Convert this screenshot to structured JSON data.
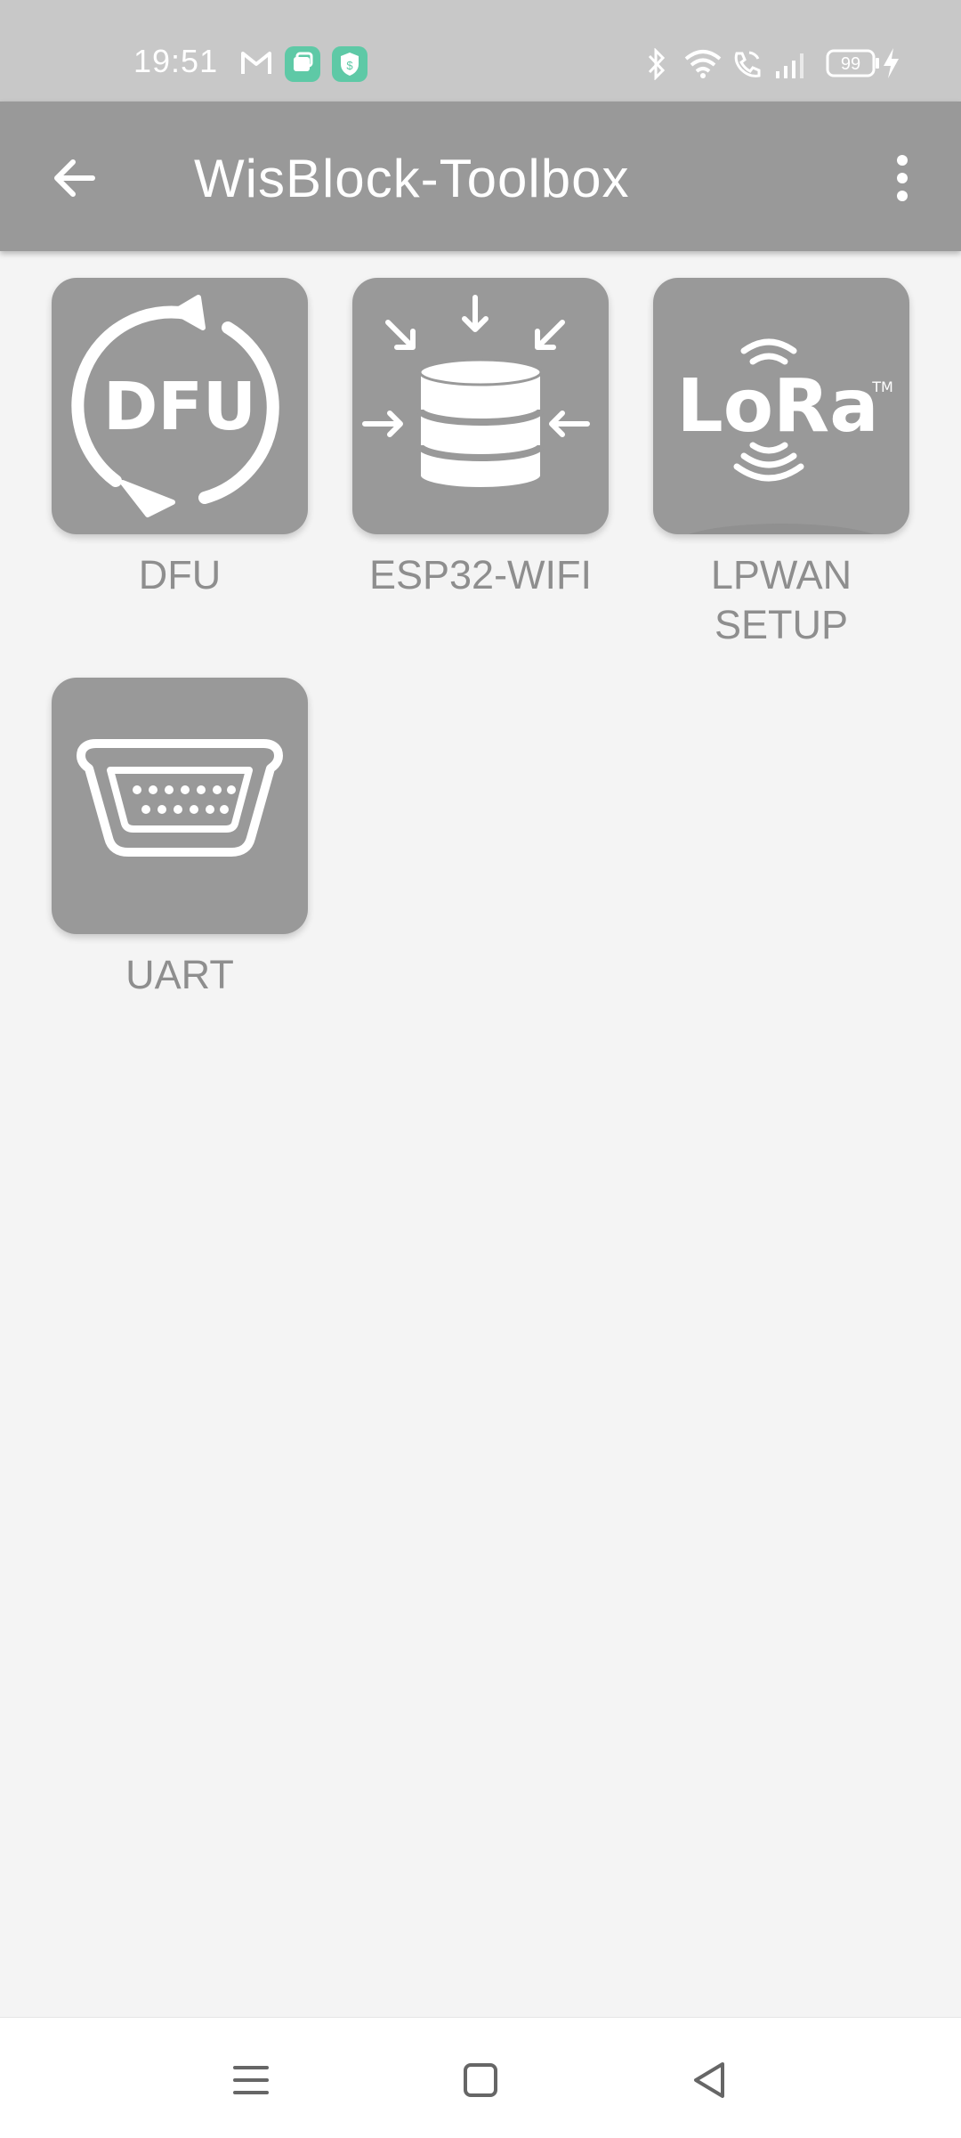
{
  "status_bar": {
    "time": "19:51",
    "battery": "99",
    "left_icons": [
      "gmail-icon",
      "notification-app-icon",
      "security-app-icon"
    ],
    "right_icons": [
      "bluetooth-icon",
      "wifi-icon",
      "wifi-calling-icon",
      "signal-icon",
      "battery-icon",
      "charging-icon"
    ]
  },
  "app_bar": {
    "title": "WisBlock-Toolbox",
    "back_icon": "arrow-back-icon",
    "menu_icon": "more-vert-icon"
  },
  "tiles": [
    {
      "label": "DFU",
      "icon": "dfu-icon",
      "icon_text": "DFU"
    },
    {
      "label": "ESP32-WIFI",
      "icon": "database-icon"
    },
    {
      "label": "LPWAN\nSETUP",
      "icon": "lora-icon",
      "icon_text": "LoRa",
      "icon_tm": "TM"
    },
    {
      "label": "UART",
      "icon": "serial-port-icon"
    }
  ],
  "nav_bar": {
    "buttons": [
      "menu-icon",
      "home-icon",
      "back-triangle-icon"
    ]
  },
  "colors": {
    "status_bar": "#c8c8c8",
    "app_bar": "#999999",
    "background": "#f4f4f4",
    "tile": "#999999",
    "label": "#8e8e8e",
    "badge_green": "#5ec9a6"
  }
}
